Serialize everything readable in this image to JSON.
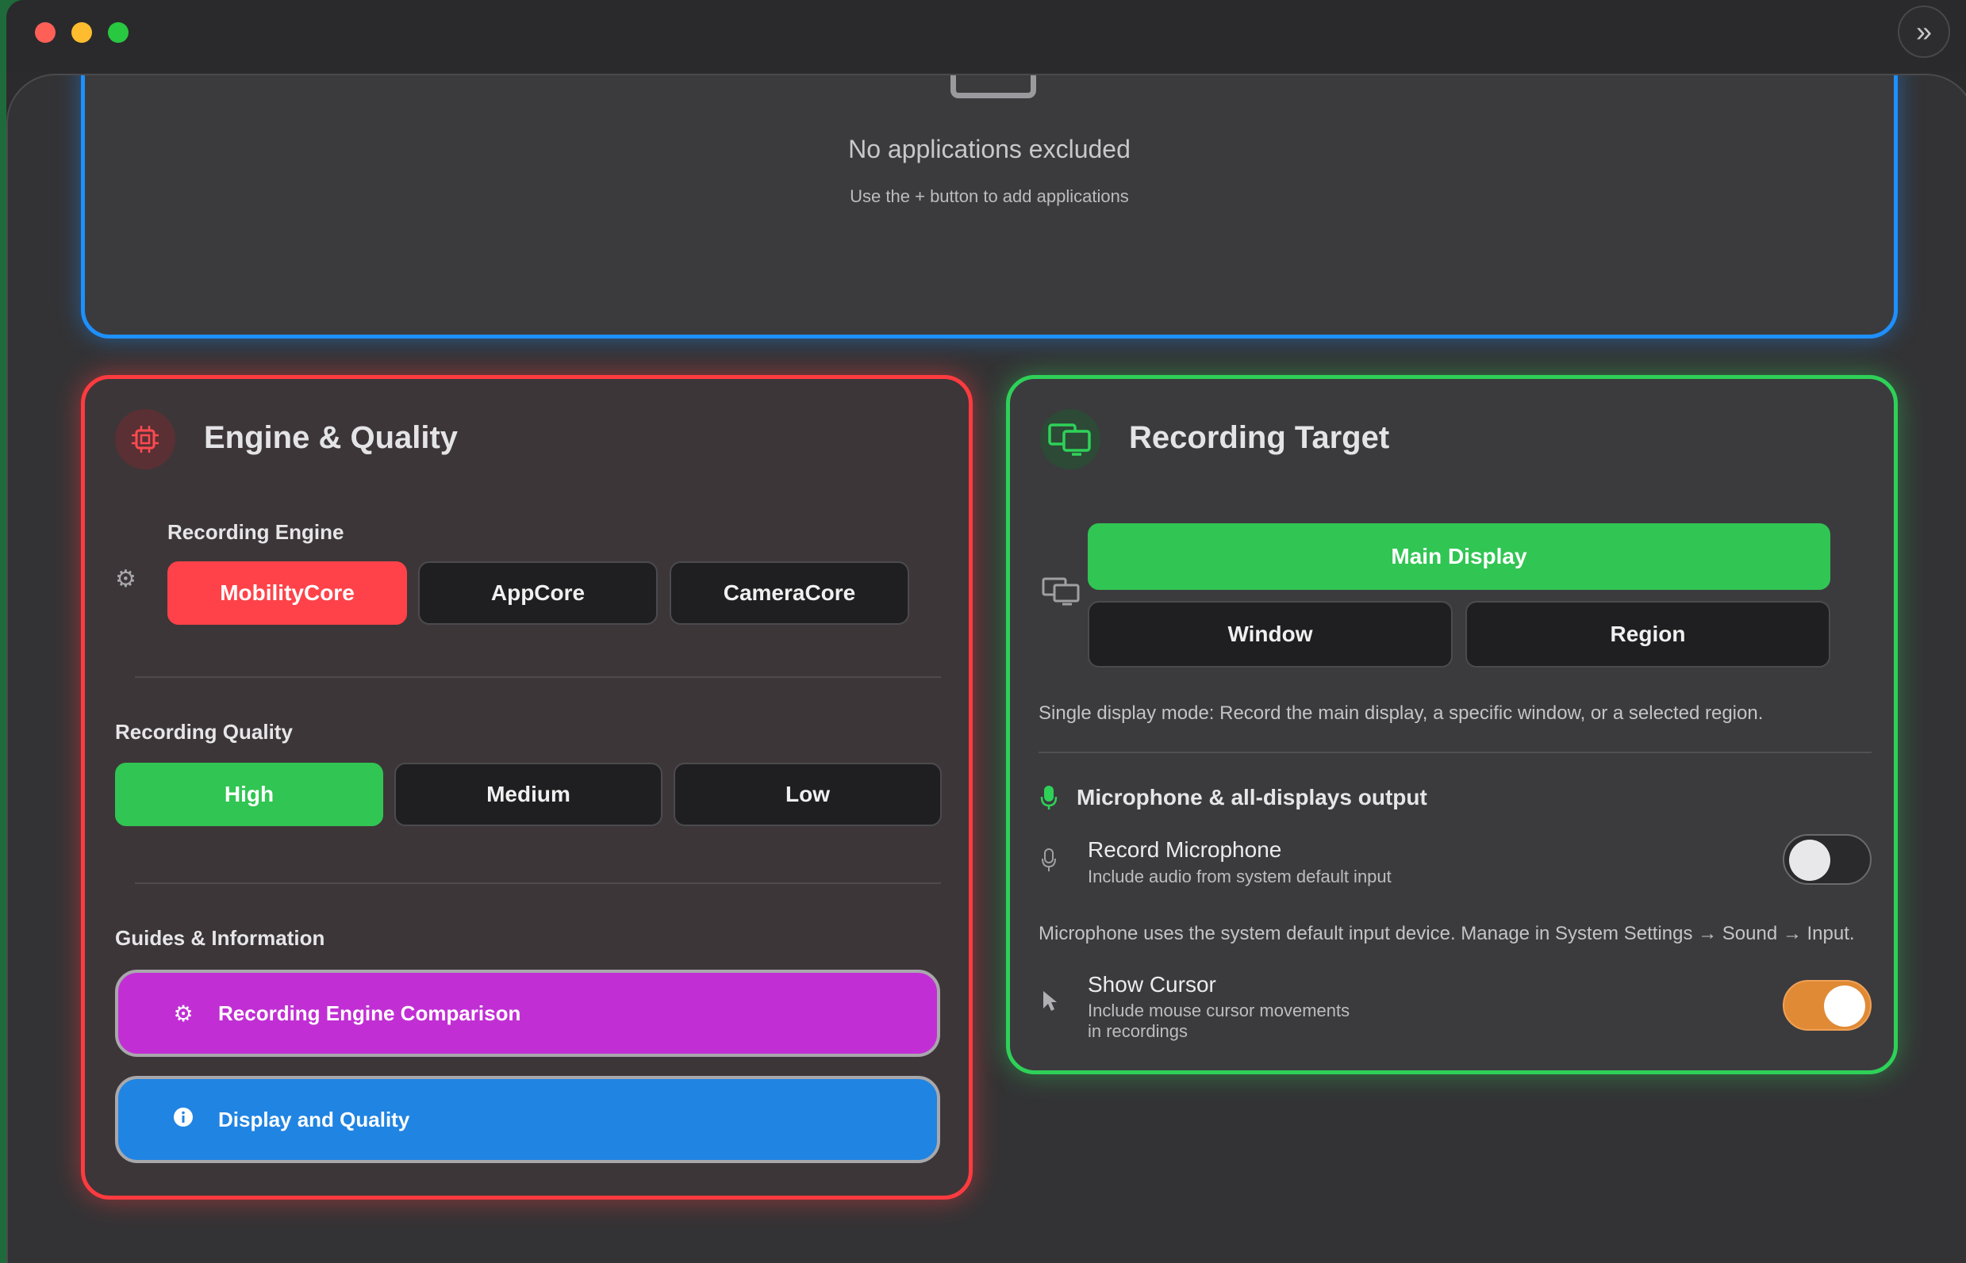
{
  "window": {
    "sidebar_toggle_icon": "chevron-double-right-icon"
  },
  "exclusions": {
    "empty_title": "No applications excluded",
    "empty_subtitle": "Use the + button to add applications"
  },
  "engine_quality": {
    "title": "Engine & Quality",
    "icon": "cpu-chip-icon",
    "accent": "#ff3b40",
    "recording_engine": {
      "label": "Recording Engine",
      "options": [
        "MobilityCore",
        "AppCore",
        "CameraCore"
      ],
      "selected": "MobilityCore"
    },
    "recording_quality": {
      "label": "Recording Quality",
      "options": [
        "High",
        "Medium",
        "Low"
      ],
      "selected": "High"
    },
    "guides": {
      "label": "Guides & Information",
      "items": [
        {
          "label": "Recording Engine Comparison",
          "icon": "gears-icon",
          "color": "#c12fd4"
        },
        {
          "label": "Display and Quality",
          "icon": "info-icon",
          "color": "#2084e2"
        }
      ]
    }
  },
  "recording_target": {
    "title": "Recording Target",
    "icon": "displays-icon",
    "accent": "#2ed158",
    "targets": [
      "Main Display",
      "Window",
      "Region"
    ],
    "selected": "Main Display",
    "description": "Single display mode: Record the main display, a specific window, or a selected region.",
    "microphone_section": {
      "title": "Microphone & all-displays output",
      "record_microphone": {
        "title": "Record Microphone",
        "subtitle": "Include audio from system default input",
        "enabled": false
      },
      "note": "Microphone uses the system default input device. Manage in System Settings → Sound → Input."
    },
    "show_cursor": {
      "title": "Show Cursor",
      "subtitle_line1": "Include mouse cursor movements",
      "subtitle_line2": "in recordings",
      "enabled": true
    }
  }
}
